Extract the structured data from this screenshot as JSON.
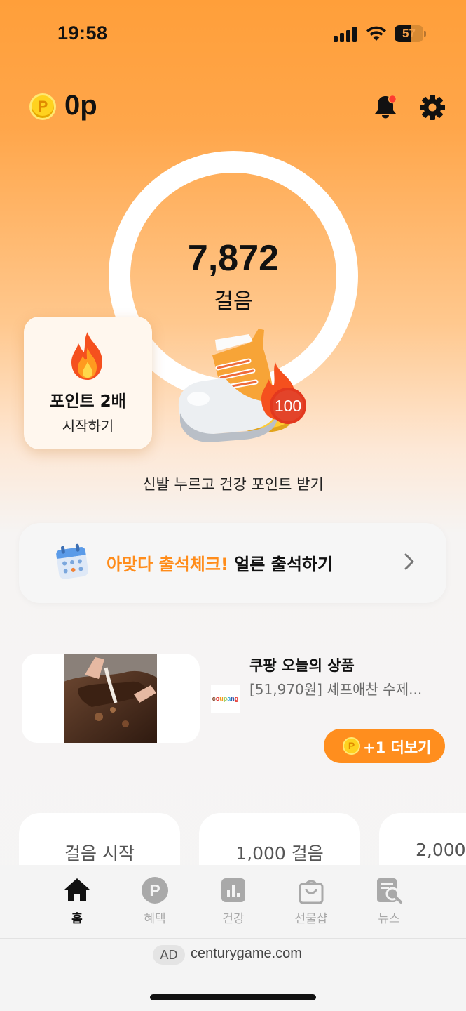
{
  "status_bar": {
    "time": "19:58",
    "battery": "57",
    "battery_level": 0.57
  },
  "header": {
    "coin_symbol": "P",
    "points": "0p",
    "bell_icon": "bell-with-red-dot",
    "settings_icon": "gear"
  },
  "step_ring": {
    "count": "7,872",
    "unit": "걸음"
  },
  "double_points": {
    "icon": "fire",
    "title": "포인트 2배",
    "subtitle": "시작하기"
  },
  "shoe": {
    "badge": "100",
    "caption": "신발 누르고 건강 포인트 받기"
  },
  "attendance": {
    "icon": "calendar",
    "accent_text": "아맞다 출석체크!",
    "text": " 얼른 출석하기"
  },
  "product": {
    "store_logo": "coupang",
    "title": "쿠팡 오늘의 상품",
    "description": "[51,970원] 셰프애찬 수제...",
    "more_coin": "P",
    "more_label": "+1 더보기"
  },
  "milestones": [
    {
      "label": "걸음 시작"
    },
    {
      "label": "1,000 걸음"
    },
    {
      "label": "2,000"
    }
  ],
  "bottom_nav": [
    {
      "label": "홈",
      "icon": "home-icon",
      "active": true
    },
    {
      "label": "혜택",
      "icon": "benefit-icon",
      "active": false
    },
    {
      "label": "건강",
      "icon": "chart-icon",
      "active": false
    },
    {
      "label": "선물샵",
      "icon": "shopping-bag-icon",
      "active": false
    },
    {
      "label": "뉴스",
      "icon": "news-icon",
      "active": false
    }
  ],
  "ad": {
    "badge": "AD",
    "domain": "centurygame.com"
  },
  "colors": {
    "accent": "#ff8e1e",
    "accent_text": "#ff8c1a",
    "notification_dot": "#ff3b30"
  }
}
